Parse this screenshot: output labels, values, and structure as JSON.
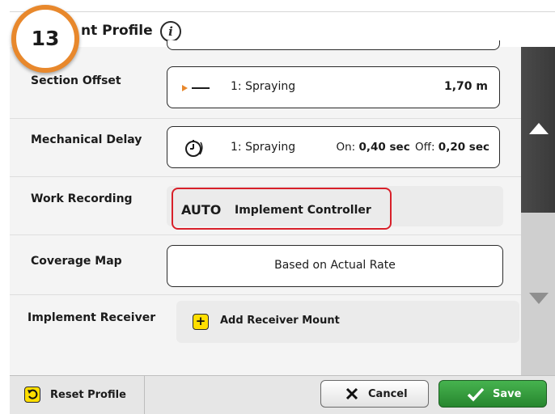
{
  "header": {
    "title": "nt Profile",
    "step_number": "13"
  },
  "rows": {
    "section_offset": {
      "label": "Section Offset",
      "section": "1: Spraying",
      "value": "1,70 m"
    },
    "mechanical_delay": {
      "label": "Mechanical Delay",
      "section": "1: Spraying",
      "on_label": "On:",
      "on_value": "0,40 sec",
      "off_label": "Off:",
      "off_value": "0,20 sec"
    },
    "work_recording": {
      "label": "Work Recording",
      "mode": "AUTO",
      "source": "Implement Controller"
    },
    "coverage_map": {
      "label": "Coverage Map",
      "value": "Based on Actual Rate"
    },
    "implement_receiver": {
      "label": "Implement Receiver",
      "button": "Add Receiver Mount"
    }
  },
  "footer": {
    "reset_label": "Reset Profile",
    "cancel_label": "Cancel",
    "save_label": "Save"
  },
  "colors": {
    "badge_ring": "#e8882c",
    "highlight_red": "#d8202a",
    "save_green": "#2f9a3a",
    "yellow_icon": "#ffde00"
  },
  "icons": [
    "info-icon",
    "offset-arrow-icon",
    "timer-icon",
    "add-icon",
    "reset-icon",
    "cancel-x-icon",
    "save-check-icon",
    "scroll-up-icon",
    "scroll-down-icon"
  ]
}
